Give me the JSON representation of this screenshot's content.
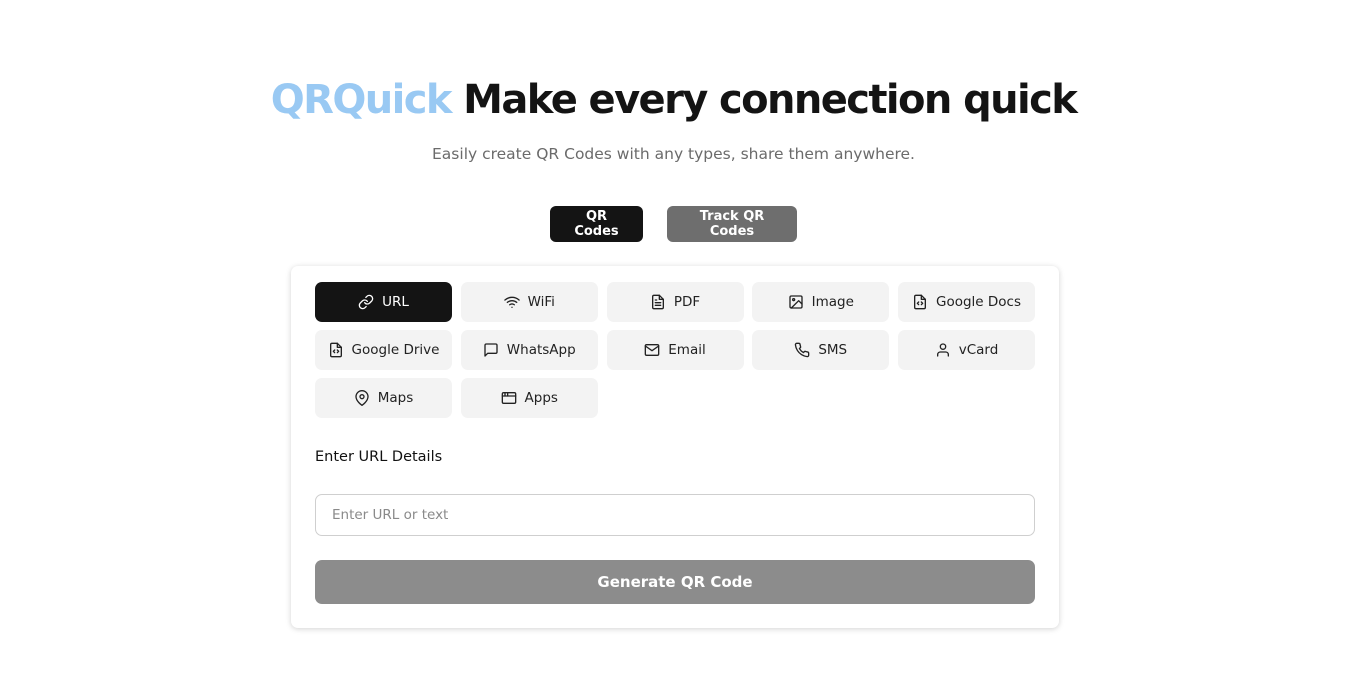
{
  "hero": {
    "brand": "QRQuick",
    "tagline": "Make every connection quick",
    "subtitle": "Easily create QR Codes with any types, share them anywhere."
  },
  "mode_tabs": [
    {
      "label": "QR Codes",
      "active": true
    },
    {
      "label": "Track QR Codes",
      "active": false
    }
  ],
  "qr_types": [
    {
      "label": "URL",
      "icon": "link-icon",
      "active": true
    },
    {
      "label": "WiFi",
      "icon": "wifi-icon"
    },
    {
      "label": "PDF",
      "icon": "file-text-icon"
    },
    {
      "label": "Image",
      "icon": "image-icon"
    },
    {
      "label": "Google Docs",
      "icon": "file-code-icon"
    },
    {
      "label": "Google Drive",
      "icon": "file-code-icon"
    },
    {
      "label": "WhatsApp",
      "icon": "message-square-icon"
    },
    {
      "label": "Email",
      "icon": "mail-icon"
    },
    {
      "label": "SMS",
      "icon": "phone-icon"
    },
    {
      "label": "vCard",
      "icon": "user-icon"
    },
    {
      "label": "Maps",
      "icon": "map-pin-icon"
    },
    {
      "label": "Apps",
      "icon": "app-window-icon"
    }
  ],
  "form": {
    "section_label": "Enter URL Details",
    "url_value": "",
    "url_placeholder": "Enter URL or text",
    "generate_label": "Generate QR Code"
  },
  "colors": {
    "brand": "#99c9f3",
    "active_bg": "#141414",
    "inactive_tab_bg": "#6e6e6e",
    "type_bg": "#f3f3f3",
    "generate_bg": "#8c8c8c"
  }
}
